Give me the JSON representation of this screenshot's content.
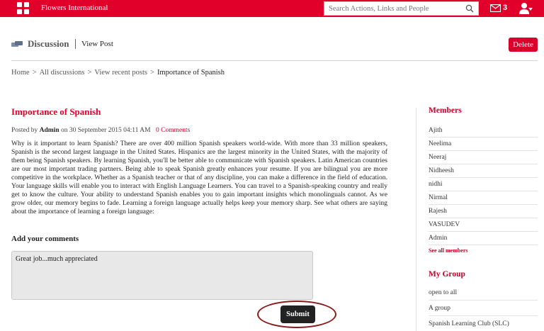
{
  "header": {
    "brand": "Flowers International",
    "search_placeholder": "Search Actions, Links and People",
    "mail_count": "3"
  },
  "page": {
    "section_title": "Discussion",
    "view_post": "View Post",
    "delete_label": "Delete"
  },
  "breadcrumb": {
    "home": "Home",
    "all_discussions": "All discussions",
    "recent_posts": "View recent posts",
    "current": "Importance of Spanish"
  },
  "post": {
    "title": "Importance of Spanish",
    "posted_by": "Posted by",
    "author": "Admin",
    "date": "on 30 September 2015 04:11 AM",
    "comments": "0 Comments",
    "body": "Why is it important to learn Spanish? There are over 400 million Spanish speakers world-wide. With more than 33 million speakers, Spanish is the second largest language in the United States. Hispanics are the largest minority in the United States, with the majority of them being Spanish speakers. By learning Spanish, you'll be better able to communicate with Spanish speakers. Latin American countries are our most important trading partners. Being able to speak Spanish greatly enhances your resume. If you are bilingual you are more competitive in the workplace. Whether as a Spanish teacher or that of any discipline, you can make a difference in the field of education. Your language skills will enable you to interact with English Language Learners. You can travel to a Spanish-speaking country and really get to know the culture. Your ability to understand Spanish enables you to gain important insights which monolinguals cannot. As we grow older, our memory begins to fade. Learning a foreign language actually helps keep your memory sharp. See what others are saying about the importance of learning a foreign language:"
  },
  "comment": {
    "label": "Add your comments",
    "value": "Great job...much appreciated",
    "submit": "Submit"
  },
  "sidebar": {
    "members_title": "Members",
    "members": [
      "Ajith",
      "Neelima",
      "Neeraj",
      "Nidheesh",
      "nidhi",
      "Nirmal",
      "Rajesh",
      "VASUDEV",
      "Admin"
    ],
    "see_all": "See all members",
    "group_title": "My Group",
    "groups": [
      "open to all",
      "A group",
      "Spanish Learning Club (SLC)"
    ]
  },
  "colors": {
    "brand_red": "#e0002a",
    "highlight_ring": "#8b1a1a"
  }
}
